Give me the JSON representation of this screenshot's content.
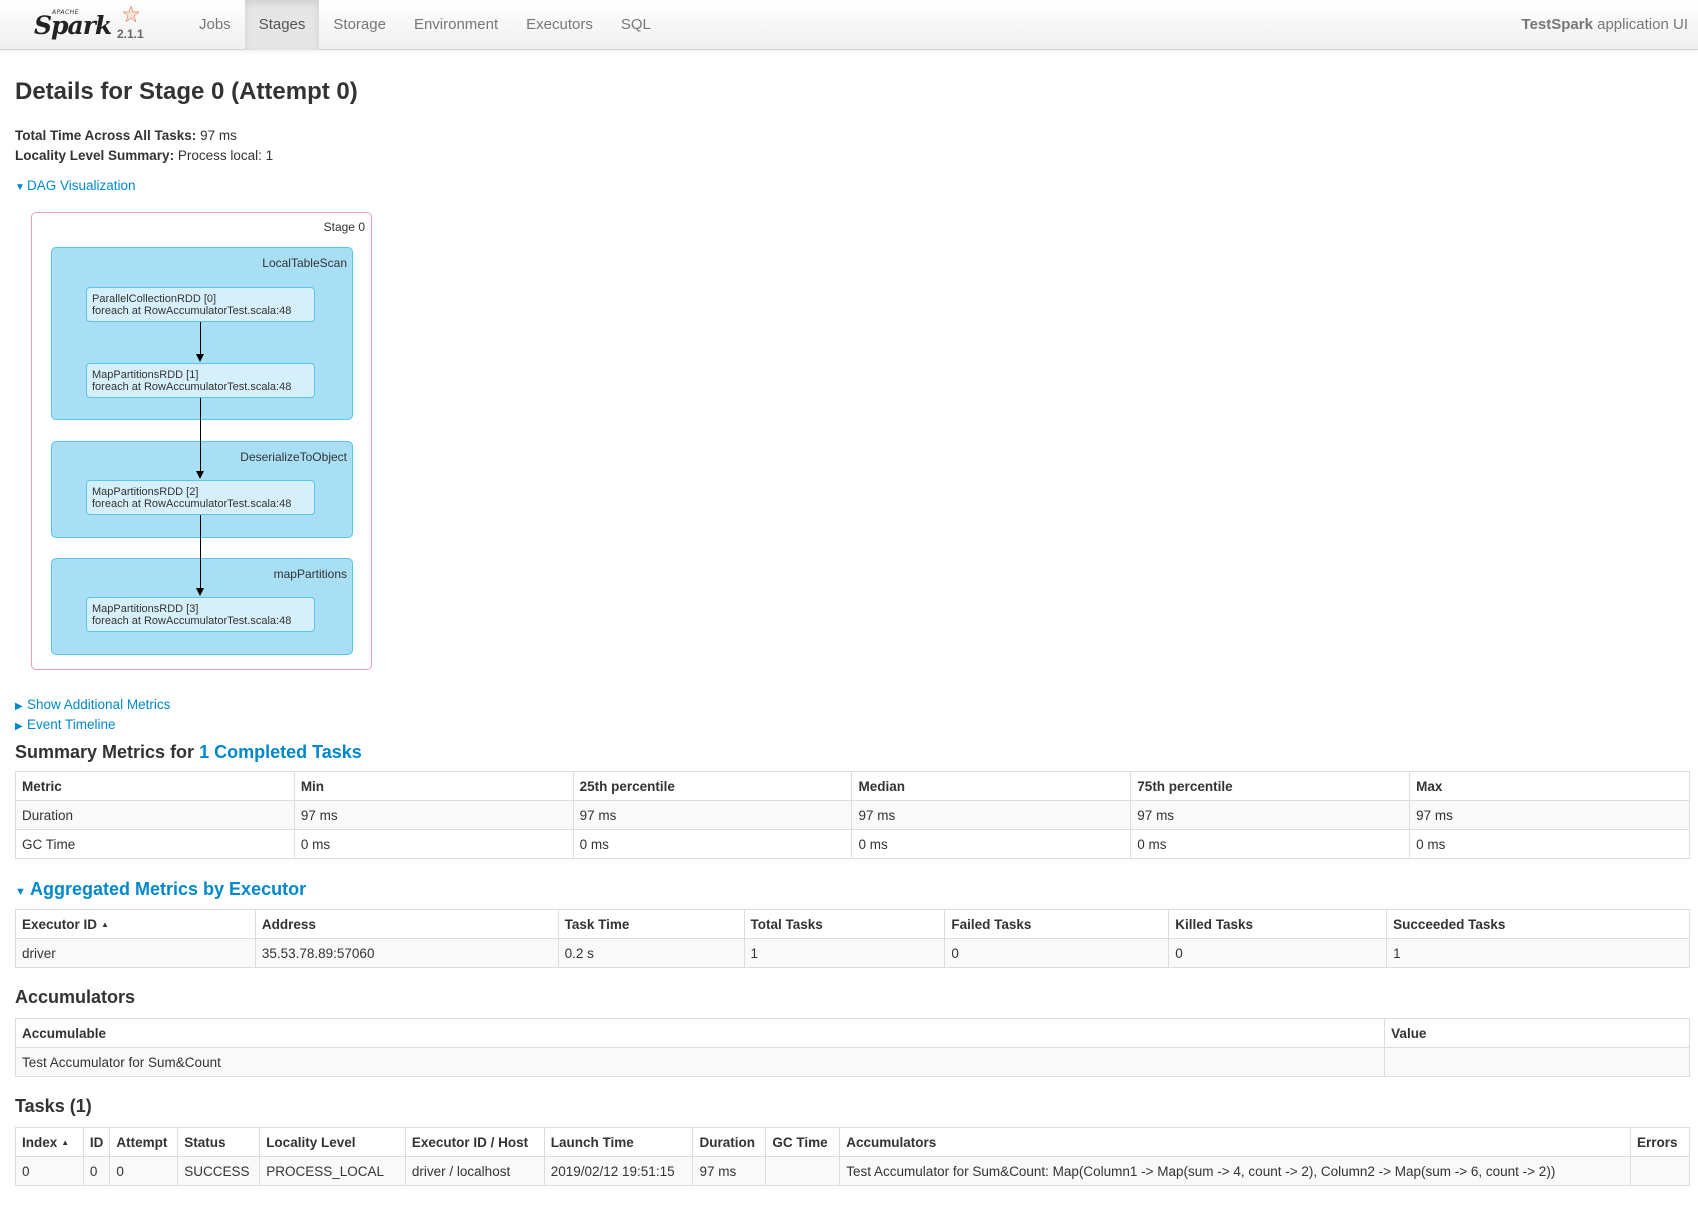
{
  "navbar": {
    "brand_apache": "APACHE",
    "brand_name": "Spark",
    "version": "2.1.1",
    "tabs": [
      {
        "label": "Jobs",
        "active": false
      },
      {
        "label": "Stages",
        "active": true
      },
      {
        "label": "Storage",
        "active": false
      },
      {
        "label": "Environment",
        "active": false
      },
      {
        "label": "Executors",
        "active": false
      },
      {
        "label": "SQL",
        "active": false
      }
    ],
    "app_name": "TestSpark",
    "app_suffix": " application UI"
  },
  "page": {
    "title": "Details for Stage 0 (Attempt 0)",
    "total_time_label": "Total Time Across All Tasks:",
    "total_time_value": " 97 ms",
    "locality_label": "Locality Level Summary:",
    "locality_value": " Process local: 1",
    "dag_toggle": "DAG Visualization",
    "show_metrics_toggle": "Show Additional Metrics",
    "event_timeline_toggle": "Event Timeline"
  },
  "dag": {
    "stage_label": "Stage 0",
    "clusters": [
      {
        "label": "LocalTableScan"
      },
      {
        "label": "DeserializeToObject"
      },
      {
        "label": "mapPartitions"
      }
    ],
    "nodes": [
      {
        "line1": "ParallelCollectionRDD [0]",
        "line2": "foreach at RowAccumulatorTest.scala:48"
      },
      {
        "line1": "MapPartitionsRDD [1]",
        "line2": "foreach at RowAccumulatorTest.scala:48"
      },
      {
        "line1": "MapPartitionsRDD [2]",
        "line2": "foreach at RowAccumulatorTest.scala:48"
      },
      {
        "line1": "MapPartitionsRDD [3]",
        "line2": "foreach at RowAccumulatorTest.scala:48"
      }
    ]
  },
  "summary_metrics": {
    "heading_prefix": "Summary Metrics for ",
    "heading_link": "1 Completed Tasks",
    "headers": [
      "Metric",
      "Min",
      "25th percentile",
      "Median",
      "75th percentile",
      "Max"
    ],
    "rows": [
      [
        "Duration",
        "97 ms",
        "97 ms",
        "97 ms",
        "97 ms",
        "97 ms"
      ],
      [
        "GC Time",
        "0 ms",
        "0 ms",
        "0 ms",
        "0 ms",
        "0 ms"
      ]
    ]
  },
  "executor_metrics": {
    "heading": "Aggregated Metrics by Executor",
    "headers": [
      "Executor ID",
      "Address",
      "Task Time",
      "Total Tasks",
      "Failed Tasks",
      "Killed Tasks",
      "Succeeded Tasks"
    ],
    "rows": [
      [
        "driver",
        "35.53.78.89:57060",
        "0.2 s",
        "1",
        "0",
        "0",
        "1"
      ]
    ]
  },
  "accumulators": {
    "heading": "Accumulators",
    "headers": [
      "Accumulable",
      "Value"
    ],
    "rows": [
      [
        "Test Accumulator for Sum&Count",
        ""
      ]
    ]
  },
  "tasks": {
    "heading": "Tasks (1)",
    "headers": [
      "Index",
      "ID",
      "Attempt",
      "Status",
      "Locality Level",
      "Executor ID / Host",
      "Launch Time",
      "Duration",
      "GC Time",
      "Accumulators",
      "Errors"
    ],
    "rows": [
      [
        "0",
        "0",
        "0",
        "SUCCESS",
        "PROCESS_LOCAL",
        "driver / localhost",
        "2019/02/12 19:51:15",
        "97 ms",
        "",
        "Test Accumulator for Sum&Count: Map(Column1 -> Map(sum -> 4, count -> 2), Column2 -> Map(sum -> 6, count -> 2))",
        ""
      ]
    ]
  },
  "colors": {
    "link": "#0088cc",
    "cluster_fill": "#a8dff5",
    "node_fill": "#d6f0fb",
    "stage_border": "#e8a0b0"
  }
}
